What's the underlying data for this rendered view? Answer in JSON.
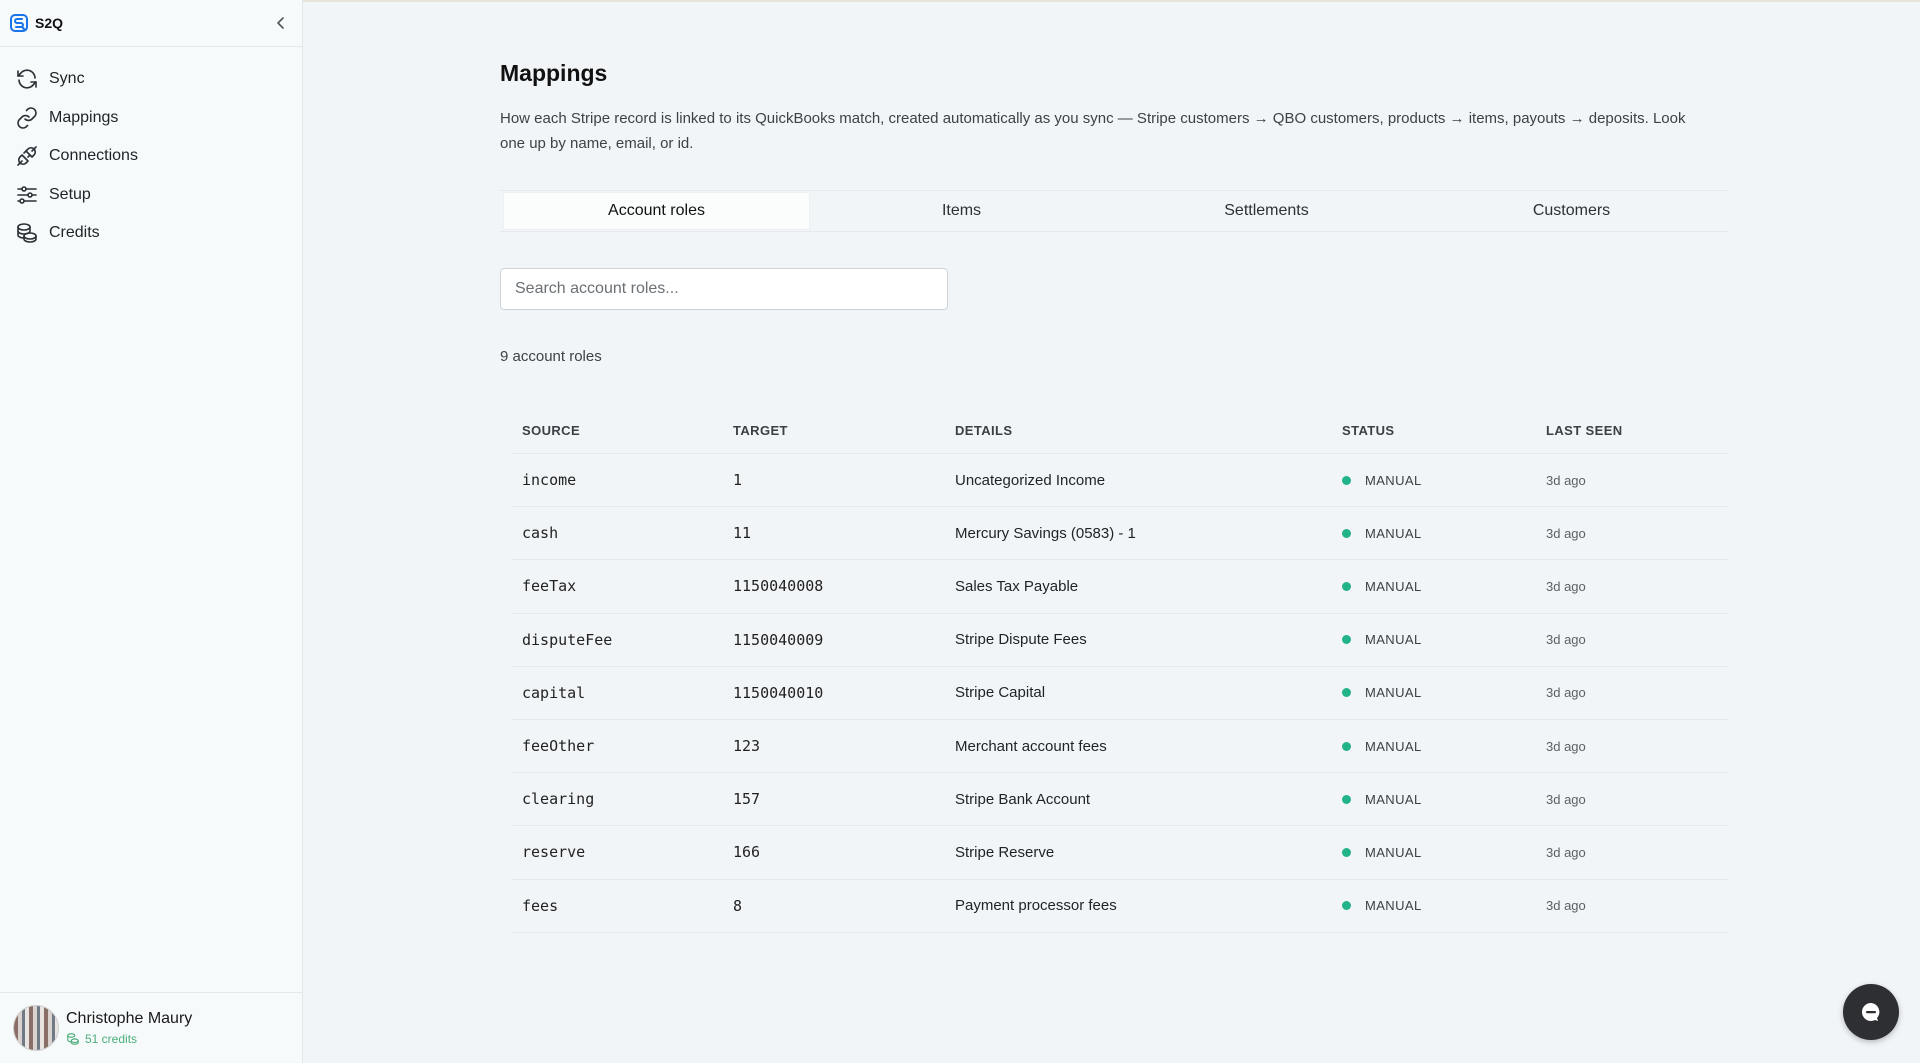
{
  "brand": "S2Q",
  "sidebar": {
    "items": [
      {
        "label": "Sync",
        "icon": "sync-icon"
      },
      {
        "label": "Mappings",
        "icon": "link-icon"
      },
      {
        "label": "Connections",
        "icon": "plug-icon"
      },
      {
        "label": "Setup",
        "icon": "sliders-icon"
      },
      {
        "label": "Credits",
        "icon": "coins-icon"
      }
    ],
    "user": {
      "name": "Christophe Maury",
      "credits": "51 credits"
    }
  },
  "page": {
    "title": "Mappings",
    "description": "How each Stripe record is linked to its QuickBooks match, created automatically as you sync — Stripe customers → QBO customers, products → items, payouts → deposits. Look one up by name, email, or id."
  },
  "tabs": [
    {
      "label": "Account roles",
      "active": true
    },
    {
      "label": "Items",
      "active": false
    },
    {
      "label": "Settlements",
      "active": false
    },
    {
      "label": "Customers",
      "active": false
    }
  ],
  "search": {
    "placeholder": "Search account roles...",
    "value": ""
  },
  "count_label": "9 account roles",
  "table": {
    "headers": {
      "source": "SOURCE",
      "target": "TARGET",
      "details": "DETAILS",
      "status": "STATUS",
      "last_seen": "LAST SEEN"
    },
    "rows": [
      {
        "source": "income",
        "target": "1",
        "details": "Uncategorized Income",
        "status": "MANUAL",
        "last_seen": "3d ago"
      },
      {
        "source": "cash",
        "target": "11",
        "details": "Mercury Savings (0583) - 1",
        "status": "MANUAL",
        "last_seen": "3d ago"
      },
      {
        "source": "feeTax",
        "target": "1150040008",
        "details": "Sales Tax Payable",
        "status": "MANUAL",
        "last_seen": "3d ago"
      },
      {
        "source": "disputeFee",
        "target": "1150040009",
        "details": "Stripe Dispute Fees",
        "status": "MANUAL",
        "last_seen": "3d ago"
      },
      {
        "source": "capital",
        "target": "1150040010",
        "details": "Stripe Capital",
        "status": "MANUAL",
        "last_seen": "3d ago"
      },
      {
        "source": "feeOther",
        "target": "123",
        "details": "Merchant account fees",
        "status": "MANUAL",
        "last_seen": "3d ago"
      },
      {
        "source": "clearing",
        "target": "157",
        "details": "Stripe Bank Account",
        "status": "MANUAL",
        "last_seen": "3d ago"
      },
      {
        "source": "reserve",
        "target": "166",
        "details": "Stripe Reserve",
        "status": "MANUAL",
        "last_seen": "3d ago"
      },
      {
        "source": "fees",
        "target": "8",
        "details": "Payment processor fees",
        "status": "MANUAL",
        "last_seen": "3d ago"
      }
    ]
  },
  "colors": {
    "accent": "#1a73e8",
    "status_manual": "#22b38a",
    "credits": "#4caf7a"
  }
}
